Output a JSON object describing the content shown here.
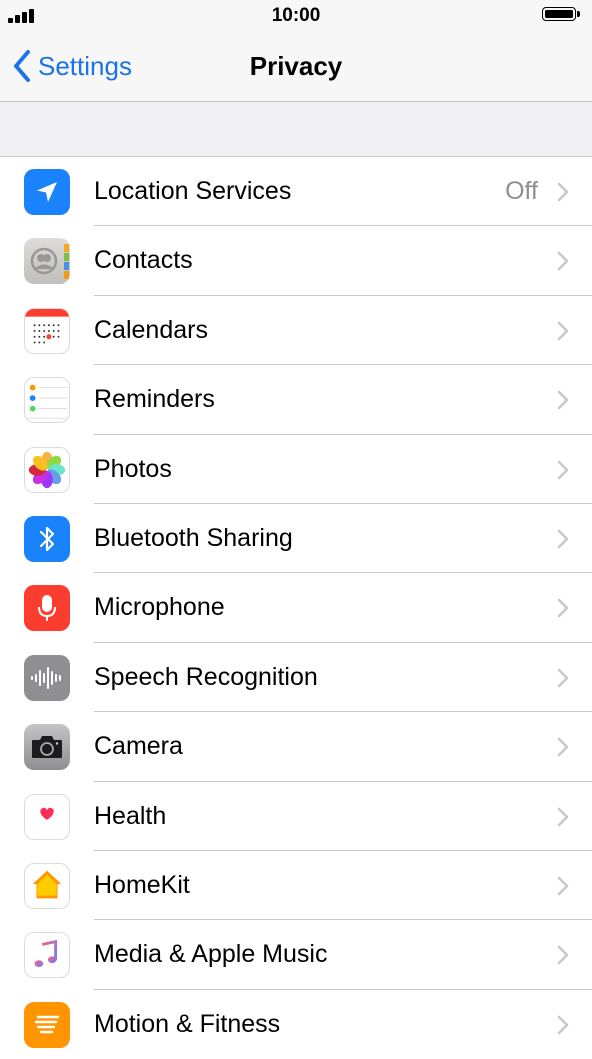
{
  "status_bar": {
    "time": "10:00"
  },
  "nav": {
    "back_label": "Settings",
    "title": "Privacy"
  },
  "rows": [
    {
      "label": "Location Services",
      "value": "Off",
      "icon": "location-icon",
      "color": "#1a82fb"
    },
    {
      "label": "Contacts",
      "value": "",
      "icon": "contacts-icon",
      "color": "#c8c7c4"
    },
    {
      "label": "Calendars",
      "value": "",
      "icon": "calendar-icon",
      "color": "#ffffff"
    },
    {
      "label": "Reminders",
      "value": "",
      "icon": "reminders-icon",
      "color": "#ffffff"
    },
    {
      "label": "Photos",
      "value": "",
      "icon": "photos-icon",
      "color": "#ffffff"
    },
    {
      "label": "Bluetooth Sharing",
      "value": "",
      "icon": "bluetooth-icon",
      "color": "#1a82fb"
    },
    {
      "label": "Microphone",
      "value": "",
      "icon": "microphone-icon",
      "color": "#fa3d2f"
    },
    {
      "label": "Speech Recognition",
      "value": "",
      "icon": "speech-recognition-icon",
      "color": "#8e8e93"
    },
    {
      "label": "Camera",
      "value": "",
      "icon": "camera-icon",
      "color": "#8e8e93"
    },
    {
      "label": "Health",
      "value": "",
      "icon": "health-icon",
      "color": "#ffffff"
    },
    {
      "label": "HomeKit",
      "value": "",
      "icon": "homekit-icon",
      "color": "#ffffff"
    },
    {
      "label": "Media & Apple Music",
      "value": "",
      "icon": "music-icon",
      "color": "#ffffff"
    },
    {
      "label": "Motion & Fitness",
      "value": "",
      "icon": "motion-fitness-icon",
      "color": "#ff9500"
    }
  ]
}
